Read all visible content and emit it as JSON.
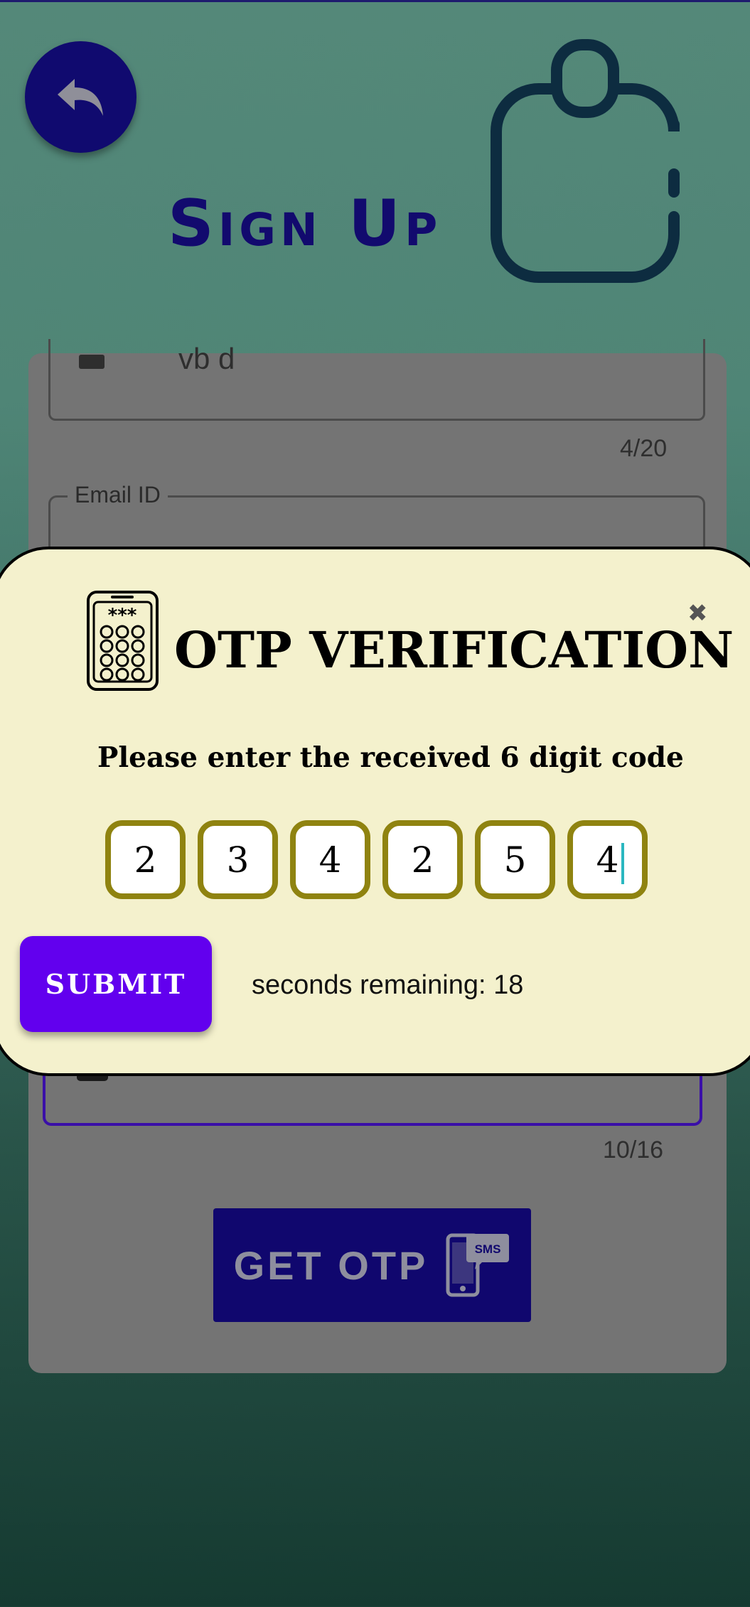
{
  "header": {
    "title": "Sign Up"
  },
  "form": {
    "name_value": "vb d",
    "name_counter": "4/20",
    "email_label": "Email ID",
    "phone_counter": "10/16",
    "get_otp_label": "GET OTP",
    "sms_badge": "SMS"
  },
  "otp_dialog": {
    "title": "OTP VERIFICATION",
    "instructions": "Please enter the received 6 digit code",
    "digits": [
      "2",
      "3",
      "4",
      "2",
      "5",
      "4"
    ],
    "submit_label": "SUBMIT",
    "timer_text": "seconds remaining: 18",
    "close_symbol": "✖"
  },
  "colors": {
    "accent": "#6200ee",
    "otp_border": "#8f8310",
    "modal_bg": "#f4f1cd",
    "navy": "#10076e"
  },
  "icons": [
    "back-arrow-icon",
    "clipboard-icon",
    "otp-keypad-icon",
    "close-icon",
    "sms-phone-icon"
  ]
}
